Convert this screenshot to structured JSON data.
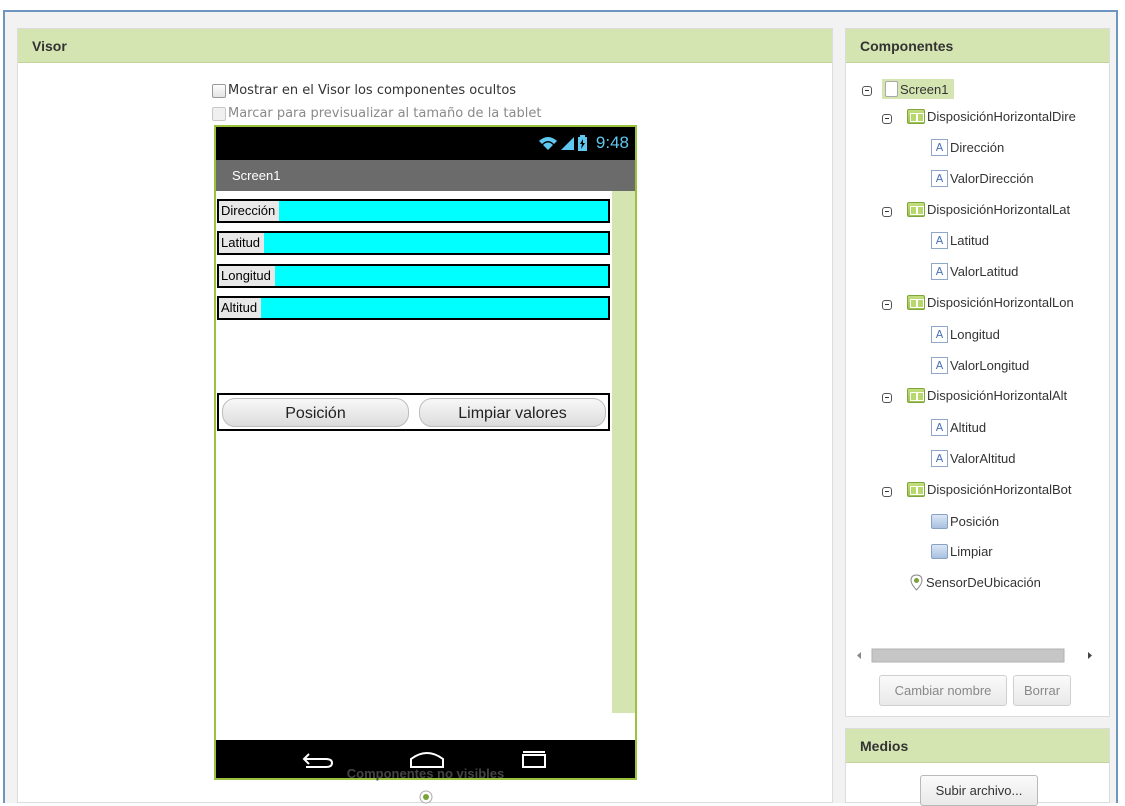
{
  "visor": {
    "title": "Visor",
    "show_hidden_label": "Mostrar en el Visor los componentes ocultos",
    "tablet_preview_label": "Marcar para previsualizar al tamaño de la tablet",
    "nonvisible_label": "Componentes no visibles"
  },
  "phone": {
    "clock": "9:48",
    "screen_title": "Screen1",
    "rows": [
      {
        "label": "Dirección"
      },
      {
        "label": "Latitud"
      },
      {
        "label": "Longitud"
      },
      {
        "label": "Altitud"
      }
    ],
    "buttons": {
      "position": "Posición",
      "clear": "Limpiar valores"
    },
    "field_color": "#00ffff"
  },
  "components": {
    "title": "Componentes",
    "tree": [
      {
        "label": "Screen1",
        "icon": "screen-icon"
      },
      {
        "label": "DisposiciónHorizontalDire",
        "icon": "horizontal-layout-icon"
      },
      {
        "label": "Dirección",
        "icon": "label-icon"
      },
      {
        "label": "ValorDirección",
        "icon": "label-icon"
      },
      {
        "label": "DisposiciónHorizontalLat",
        "icon": "horizontal-layout-icon"
      },
      {
        "label": "Latitud",
        "icon": "label-icon"
      },
      {
        "label": "ValorLatitud",
        "icon": "label-icon"
      },
      {
        "label": "DisposiciónHorizontalLon",
        "icon": "horizontal-layout-icon"
      },
      {
        "label": "Longitud",
        "icon": "label-icon"
      },
      {
        "label": "ValorLongitud",
        "icon": "label-icon"
      },
      {
        "label": "DisposiciónHorizontalAlt",
        "icon": "horizontal-layout-icon"
      },
      {
        "label": "Altitud",
        "icon": "label-icon"
      },
      {
        "label": "ValorAltitud",
        "icon": "label-icon"
      },
      {
        "label": "DisposiciónHorizontalBot",
        "icon": "horizontal-layout-icon"
      },
      {
        "label": "Posición",
        "icon": "button-icon"
      },
      {
        "label": "Limpiar",
        "icon": "button-icon"
      },
      {
        "label": "SensorDeUbicación",
        "icon": "location-sensor-icon"
      }
    ],
    "rename_button": "Cambiar nombre",
    "delete_button": "Borrar"
  },
  "media": {
    "title": "Medios",
    "upload_button": "Subir archivo..."
  },
  "colors": {
    "header_green": "#d5e5b2",
    "phone_border": "#9bc23d",
    "accent_blue": "#5fc8f0"
  }
}
